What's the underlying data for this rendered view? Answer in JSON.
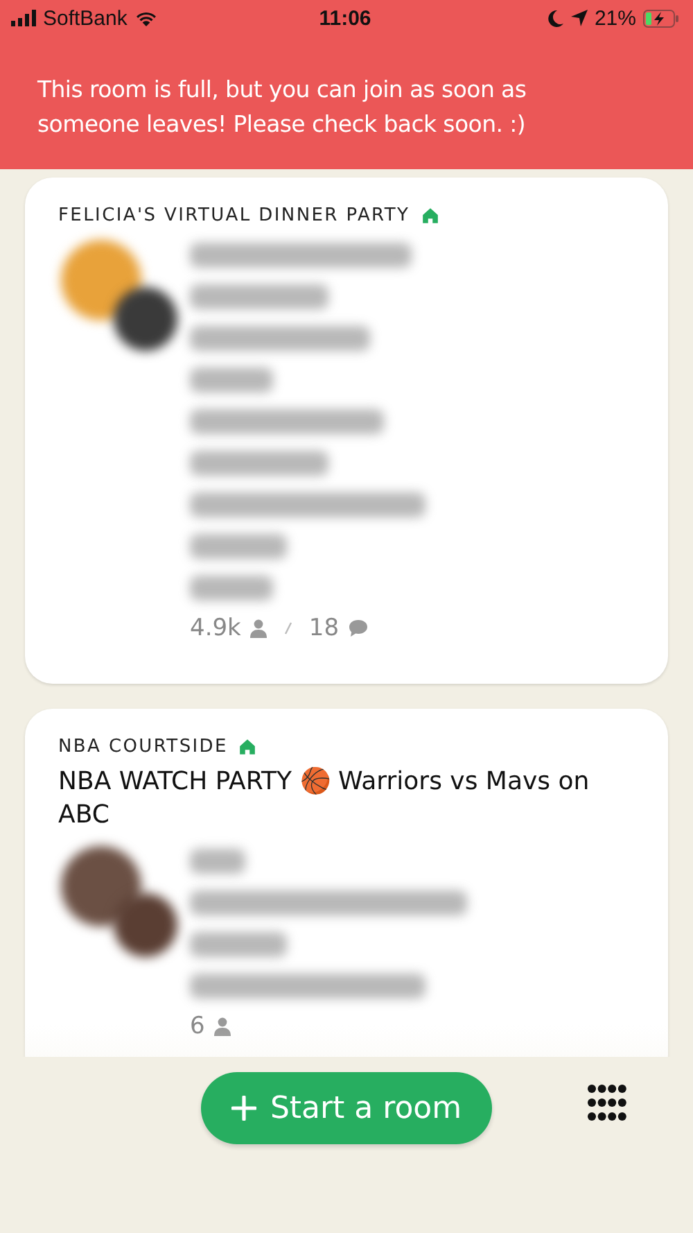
{
  "status_bar": {
    "carrier": "SoftBank",
    "time": "11:06",
    "battery": "21%"
  },
  "banner": {
    "message": "This room is full, but you can join as soon as someone leaves! Please check back soon. :)"
  },
  "rooms": [
    {
      "club": "FELICIA'S VIRTUAL DINNER PARTY",
      "listeners": "4.9k",
      "speakers": "18"
    },
    {
      "club": "NBA COURTSIDE",
      "title": "NBA WATCH PARTY 🏀 Warriors vs Mavs on ABC",
      "listeners": "6"
    }
  ],
  "start_button": {
    "label": "Start a room"
  }
}
